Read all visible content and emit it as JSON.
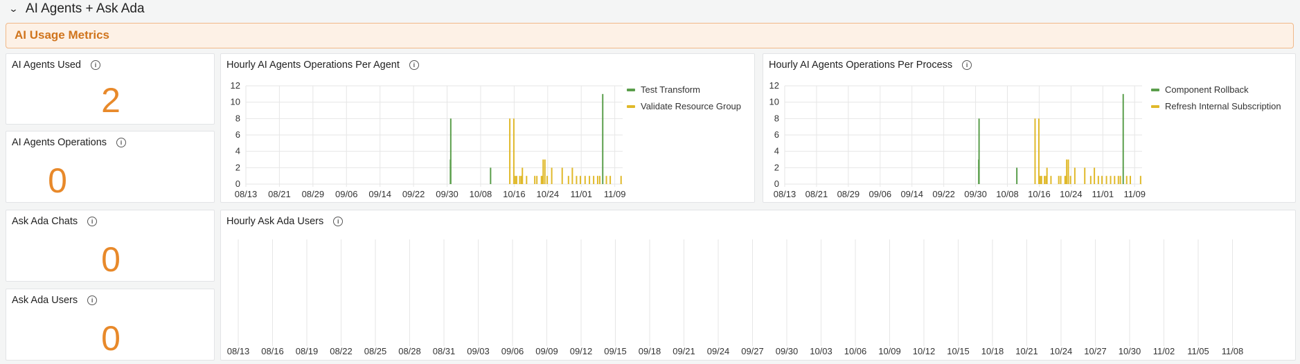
{
  "section": {
    "title": "AI Agents + Ask Ada",
    "chevron_icon": "chevron-down-icon"
  },
  "banner": {
    "title": "AI Usage Metrics"
  },
  "colors": {
    "accent": "#e8892a",
    "green": "#5a9e4b",
    "yellow": "#e0b92a"
  },
  "stats": [
    {
      "label": "AI Agents Used",
      "value": "2"
    },
    {
      "label": "AI Agents Operations",
      "value": "0"
    },
    {
      "label": "Ask Ada Chats",
      "value": "0"
    },
    {
      "label": "Ask Ada Users",
      "value": "0"
    }
  ],
  "chart_data": [
    {
      "type": "bar",
      "title": "Hourly AI Agents Operations Per Agent",
      "ylim": [
        0,
        12
      ],
      "yticks": [
        "0",
        "2",
        "4",
        "6",
        "8",
        "10",
        "12"
      ],
      "xticks": [
        "08/13",
        "08/21",
        "08/29",
        "09/06",
        "09/14",
        "09/22",
        "09/30",
        "10/08",
        "10/16",
        "10/24",
        "11/01",
        "11/09"
      ],
      "xlim": [
        "08/13 00:00",
        "11/10 21:00"
      ],
      "grid": true,
      "legend": "right",
      "series": [
        {
          "name": "Test Transform",
          "color": "#5a9e4b",
          "points": [
            [
              "09/30 19:00",
              3
            ],
            [
              "09/30 21:00",
              8
            ],
            [
              "10/10 09:00",
              2
            ],
            [
              "11/06 03:00",
              11
            ]
          ]
        },
        {
          "name": "Validate Resource Group",
          "color": "#e0b92a",
          "points": [
            [
              "10/14 23:00",
              8
            ],
            [
              "10/15 22:00",
              8
            ],
            [
              "10/16 06:00",
              1
            ],
            [
              "10/16 14:00",
              1
            ],
            [
              "10/17 08:00",
              1
            ],
            [
              "10/17 17:00",
              1
            ],
            [
              "10/17 23:00",
              2
            ],
            [
              "10/18 23:00",
              1
            ],
            [
              "10/20 22:00",
              1
            ],
            [
              "10/21 10:00",
              1
            ],
            [
              "10/22 12:00",
              1
            ],
            [
              "10/22 18:00",
              1
            ],
            [
              "10/22 22:00",
              3
            ],
            [
              "10/23 08:00",
              3
            ],
            [
              "10/23 21:00",
              1
            ],
            [
              "10/24 23:00",
              2
            ],
            [
              "10/27 11:00",
              2
            ],
            [
              "10/28 23:00",
              1
            ],
            [
              "10/29 21:00",
              2
            ],
            [
              "10/30 21:00",
              1
            ],
            [
              "10/31 19:00",
              1
            ],
            [
              "11/01 22:00",
              1
            ],
            [
              "11/02 23:00",
              1
            ],
            [
              "11/03 23:00",
              1
            ],
            [
              "11/04 22:00",
              1
            ],
            [
              "11/05 10:00",
              1
            ],
            [
              "11/07 00:00",
              1
            ],
            [
              "11/07 22:00",
              1
            ],
            [
              "11/10 12:00",
              1
            ]
          ]
        }
      ]
    },
    {
      "type": "bar",
      "title": "Hourly AI Agents Operations Per Process",
      "ylim": [
        0,
        12
      ],
      "yticks": [
        "0",
        "2",
        "4",
        "6",
        "8",
        "10",
        "12"
      ],
      "xticks": [
        "08/13",
        "08/21",
        "08/29",
        "09/06",
        "09/14",
        "09/22",
        "09/30",
        "10/08",
        "10/16",
        "10/24",
        "11/01",
        "11/09"
      ],
      "xlim": [
        "08/13 00:00",
        "11/10 21:00"
      ],
      "grid": true,
      "legend": "right",
      "series": [
        {
          "name": "Component Rollback",
          "color": "#5a9e4b",
          "points": [
            [
              "09/30 19:00",
              3
            ],
            [
              "09/30 21:00",
              8
            ],
            [
              "10/10 09:00",
              2
            ],
            [
              "11/06 03:00",
              11
            ]
          ]
        },
        {
          "name": "Refresh Internal Subscription",
          "color": "#e0b92a",
          "points": [
            [
              "10/14 23:00",
              8
            ],
            [
              "10/15 22:00",
              8
            ],
            [
              "10/16 06:00",
              1
            ],
            [
              "10/16 14:00",
              1
            ],
            [
              "10/17 08:00",
              1
            ],
            [
              "10/17 17:00",
              1
            ],
            [
              "10/17 23:00",
              2
            ],
            [
              "10/18 23:00",
              1
            ],
            [
              "10/20 22:00",
              1
            ],
            [
              "10/21 10:00",
              1
            ],
            [
              "10/22 12:00",
              1
            ],
            [
              "10/22 18:00",
              1
            ],
            [
              "10/22 22:00",
              3
            ],
            [
              "10/23 08:00",
              3
            ],
            [
              "10/23 21:00",
              1
            ],
            [
              "10/24 23:00",
              2
            ],
            [
              "10/27 11:00",
              2
            ],
            [
              "10/28 23:00",
              1
            ],
            [
              "10/29 21:00",
              2
            ],
            [
              "10/30 21:00",
              1
            ],
            [
              "10/31 19:00",
              1
            ],
            [
              "11/01 22:00",
              1
            ],
            [
              "11/02 23:00",
              1
            ],
            [
              "11/03 23:00",
              1
            ],
            [
              "11/04 22:00",
              1
            ],
            [
              "11/05 10:00",
              1
            ],
            [
              "11/07 00:00",
              1
            ],
            [
              "11/07 22:00",
              1
            ],
            [
              "11/10 12:00",
              1
            ]
          ]
        }
      ]
    },
    {
      "type": "bar",
      "title": "Hourly Ask Ada Users",
      "xticks": [
        "08/13",
        "08/16",
        "08/19",
        "08/22",
        "08/25",
        "08/28",
        "08/31",
        "09/03",
        "09/06",
        "09/09",
        "09/12",
        "09/15",
        "09/18",
        "09/21",
        "09/24",
        "09/27",
        "09/30",
        "10/03",
        "10/06",
        "10/09",
        "10/12",
        "10/15",
        "10/18",
        "10/21",
        "10/24",
        "10/27",
        "10/30",
        "11/02",
        "11/05",
        "11/08"
      ],
      "grid": true,
      "series": []
    }
  ]
}
